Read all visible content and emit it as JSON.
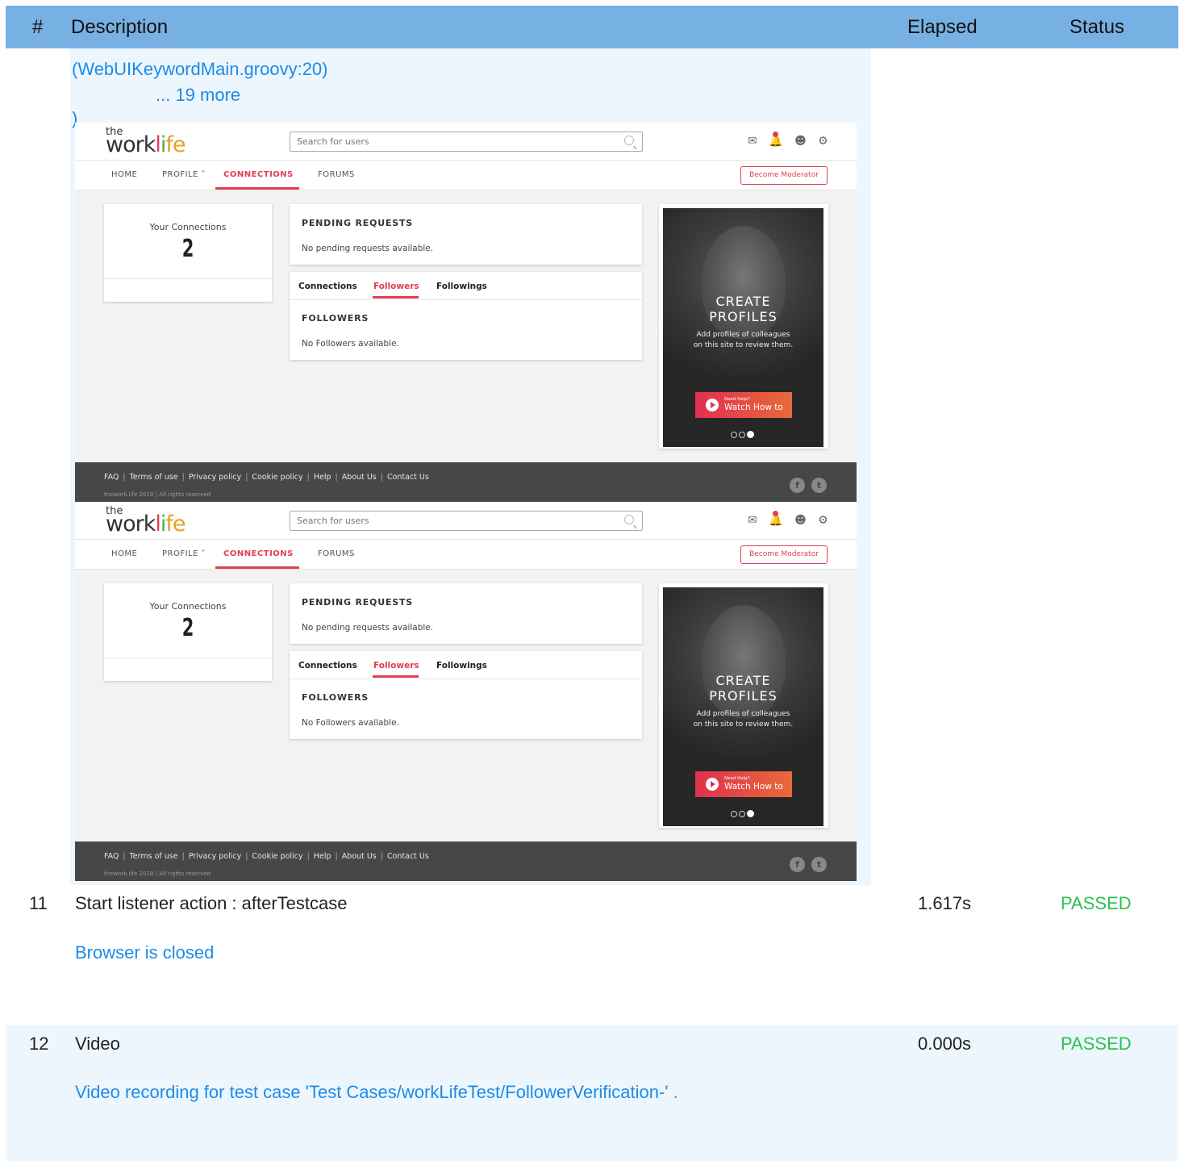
{
  "header": {
    "num": "#",
    "description": "Description",
    "elapsed": "Elapsed",
    "status": "Status"
  },
  "stack": {
    "line1": "(WebUIKeywordMain.groovy:20)",
    "line2": "... 19 more",
    "line3": ")"
  },
  "screenshot": {
    "logo": {
      "the": "the",
      "work": "work",
      "life_l": "l",
      "life_i": "i",
      "life_fe": "fe"
    },
    "search_placeholder": "Search for users",
    "nav": {
      "home": "HOME",
      "profile": "PROFILE ˅",
      "connections": "CONNECTIONS",
      "forums": "FORUMS"
    },
    "moderator": "Become Moderator",
    "connections_card": {
      "label": "Your Connections",
      "count": "2"
    },
    "pending": {
      "title": "PENDING REQUESTS",
      "text": "No pending requests available."
    },
    "tabs": {
      "connections": "Connections",
      "followers": "Followers",
      "followings": "Followings"
    },
    "followers": {
      "title": "FOLLOWERS",
      "text": "No Followers available."
    },
    "promo": {
      "line1": "CREATE",
      "line2": "PROFILES",
      "sub1": "Add profiles of colleagues",
      "sub2": "on this site to review them.",
      "btn_small": "Need Help?",
      "btn_big": "Watch How to"
    },
    "footer": {
      "faq": "FAQ",
      "terms": "Terms of use",
      "privacy": "Privacy policy",
      "cookie": "Cookie policy",
      "help": "Help",
      "about": "About Us",
      "contact": "Contact Us",
      "copyright": "thework.life 2018 | All rights reserved",
      "fb": "f",
      "tw": "t"
    }
  },
  "rows": [
    {
      "num": "11",
      "description": "Start listener action : afterTestcase",
      "elapsed": "1.617s",
      "status": "PASSED",
      "message": "Browser is closed"
    },
    {
      "num": "12",
      "description": "Video",
      "elapsed": "0.000s",
      "status": "PASSED",
      "message": "Video recording for test case 'Test Cases/workLifeTest/FollowerVerification-' ."
    }
  ],
  "colors": {
    "header": "#77b0e3",
    "link": "#1a8be8",
    "passed": "#2cc24e",
    "accent": "#e03e52",
    "row_alt": "#eef6fd"
  }
}
